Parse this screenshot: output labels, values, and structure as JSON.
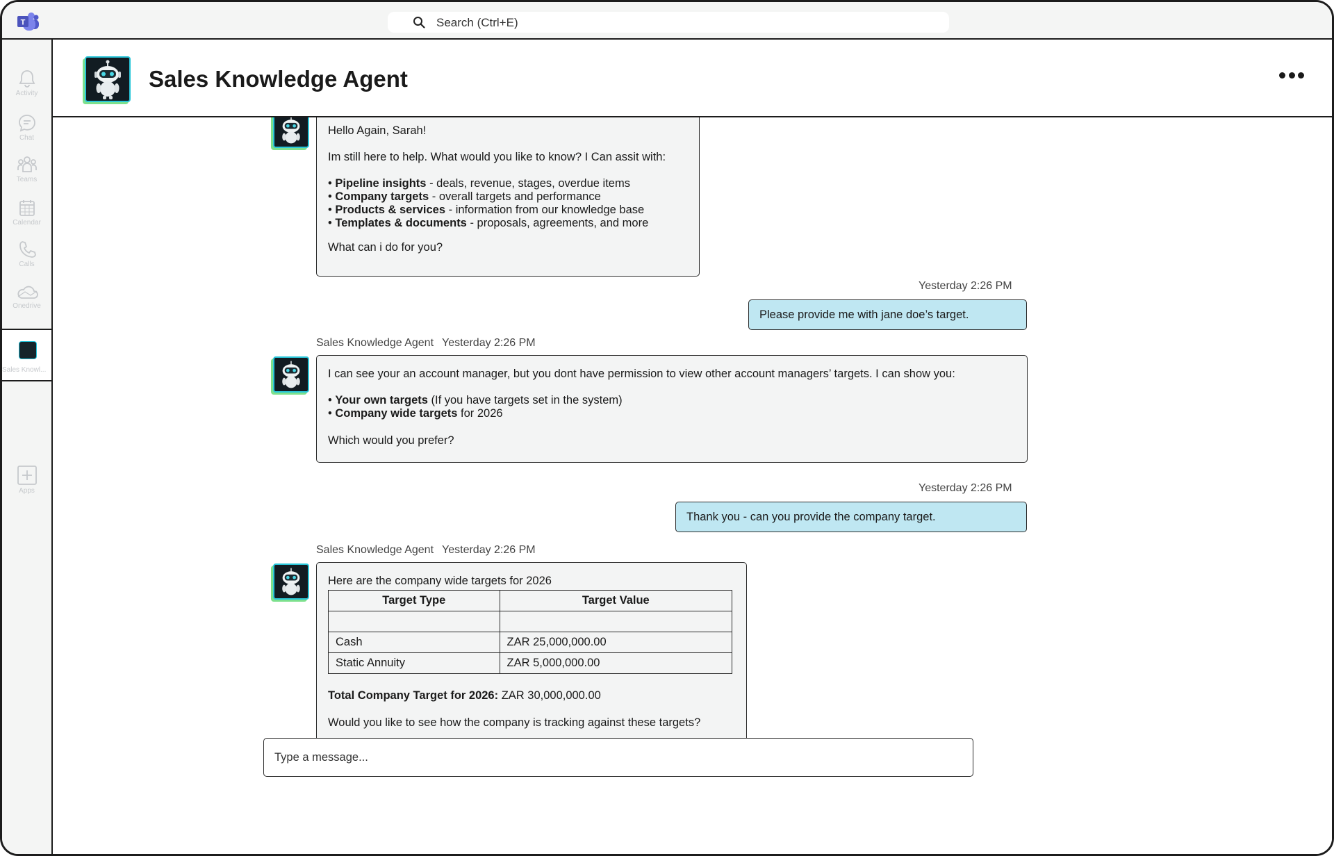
{
  "search": {
    "placeholder": "Search (Ctrl+E)"
  },
  "rail": {
    "items": [
      {
        "label": "Activity",
        "icon": "bell-icon"
      },
      {
        "label": "Chat",
        "icon": "chat-icon"
      },
      {
        "label": "Teams",
        "icon": "teams-icon"
      },
      {
        "label": "Calendar",
        "icon": "calendar-icon"
      },
      {
        "label": "Calls",
        "icon": "phone-icon"
      },
      {
        "label": "Onedrive",
        "icon": "cloud-icon"
      }
    ],
    "active_label": "Sales Knowl...",
    "apps_label": "Apps"
  },
  "header": {
    "title": "Sales Knowledge Agent"
  },
  "messages": {
    "m1": {
      "greeting": "Hello Again, Sarah!",
      "intro": "Im still here to help. What would you like to know? I Can assit with:",
      "bullets": [
        {
          "bold": "Pipeline insights",
          "rest": " - deals, revenue, stages, overdue items"
        },
        {
          "bold": "Company targets",
          "rest": " - overall targets and performance"
        },
        {
          "bold": "Products & services",
          "rest": " - information from our knowledge base"
        },
        {
          "bold": "Templates & documents",
          "rest": " - proposals, agreements, and more"
        }
      ],
      "closing": "What can i do for you?"
    },
    "u1": {
      "time": "Yesterday 2:26 PM",
      "text": "Please provide me with jane doe’s target."
    },
    "m2": {
      "sender": "Sales Knowledge Agent",
      "time": "Yesterday 2:26 PM",
      "intro": "I can see your an account manager, but you dont have permission to view other account managers’ targets. I can show you:",
      "bullets": [
        {
          "bold": "Your own targets",
          "rest": " (If you have targets set in the system)"
        },
        {
          "bold": "Company wide targets",
          "rest": " for 2026"
        }
      ],
      "closing": "Which would you prefer?"
    },
    "u2": {
      "time": "Yesterday 2:26 PM",
      "text": "Thank you - can you provide the company target."
    },
    "m3": {
      "sender": "Sales Knowledge Agent",
      "time": "Yesterday 2:26 PM",
      "intro": "Here are the company wide targets for 2026",
      "table": {
        "headers": [
          "Target Type",
          "Target Value"
        ],
        "rows": [
          [
            "",
            ""
          ],
          [
            "Cash",
            "ZAR 25,000,000.00"
          ],
          [
            "Static Annuity",
            "ZAR 5,000,000.00"
          ]
        ]
      },
      "total_label": "Total Company Target for 2026:",
      "total_value": " ZAR 30,000,000.00",
      "closing": "Would you like to see how the company is tracking against these targets?"
    }
  },
  "composer": {
    "placeholder": "Type a message..."
  },
  "colors": {
    "bot_bubble": "#f3f4f4",
    "user_bubble": "#bfe7f2",
    "avatar_border": "#29c6d9",
    "avatar_shadow": "#7de08d"
  }
}
